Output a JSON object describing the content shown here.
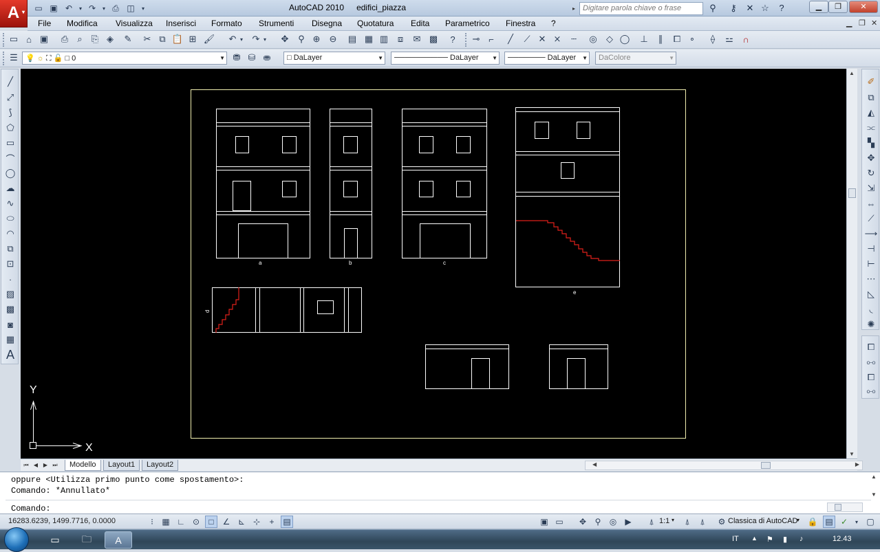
{
  "titlebar": {
    "app_name": "AutoCAD 2010",
    "document": "edifici_piazza",
    "search_placeholder": "Digitare parola chiave o frase",
    "logo_letter": "A"
  },
  "menu": [
    "File",
    "Modifica",
    "Visualizza",
    "Inserisci",
    "Formato",
    "Strumenti",
    "Disegna",
    "Quotatura",
    "Edita",
    "Parametrico",
    "Finestra",
    "?"
  ],
  "layers_toolbar": {
    "current_layer": "0",
    "color": "DaLayer",
    "linetype": "DaLayer",
    "lineweight": "DaLayer",
    "plotstyle": "DaColore"
  },
  "drawing": {
    "labels": {
      "a": "a",
      "b": "b",
      "c": "c",
      "d": "d",
      "e": "e"
    },
    "ucs_x": "X",
    "ucs_y": "Y",
    "colors": {
      "background": "#000000",
      "lines": "#ffffff",
      "border": "#f2f0b0",
      "stairs": "#e0201a"
    }
  },
  "tabs": [
    "Modello",
    "Layout1",
    "Layout2"
  ],
  "command": {
    "history_1": "oppure <Utilizza primo punto come spostamento>:",
    "history_2": "Comando: *Annullato*",
    "prompt": "Comando:"
  },
  "status": {
    "coordinates": "16283.6239, 1499.7716, 0.0000",
    "annotation_scale": "1:1",
    "workspace": "Classica di AutoCAD"
  },
  "taskbar": {
    "language": "IT",
    "clock": "12.43"
  }
}
